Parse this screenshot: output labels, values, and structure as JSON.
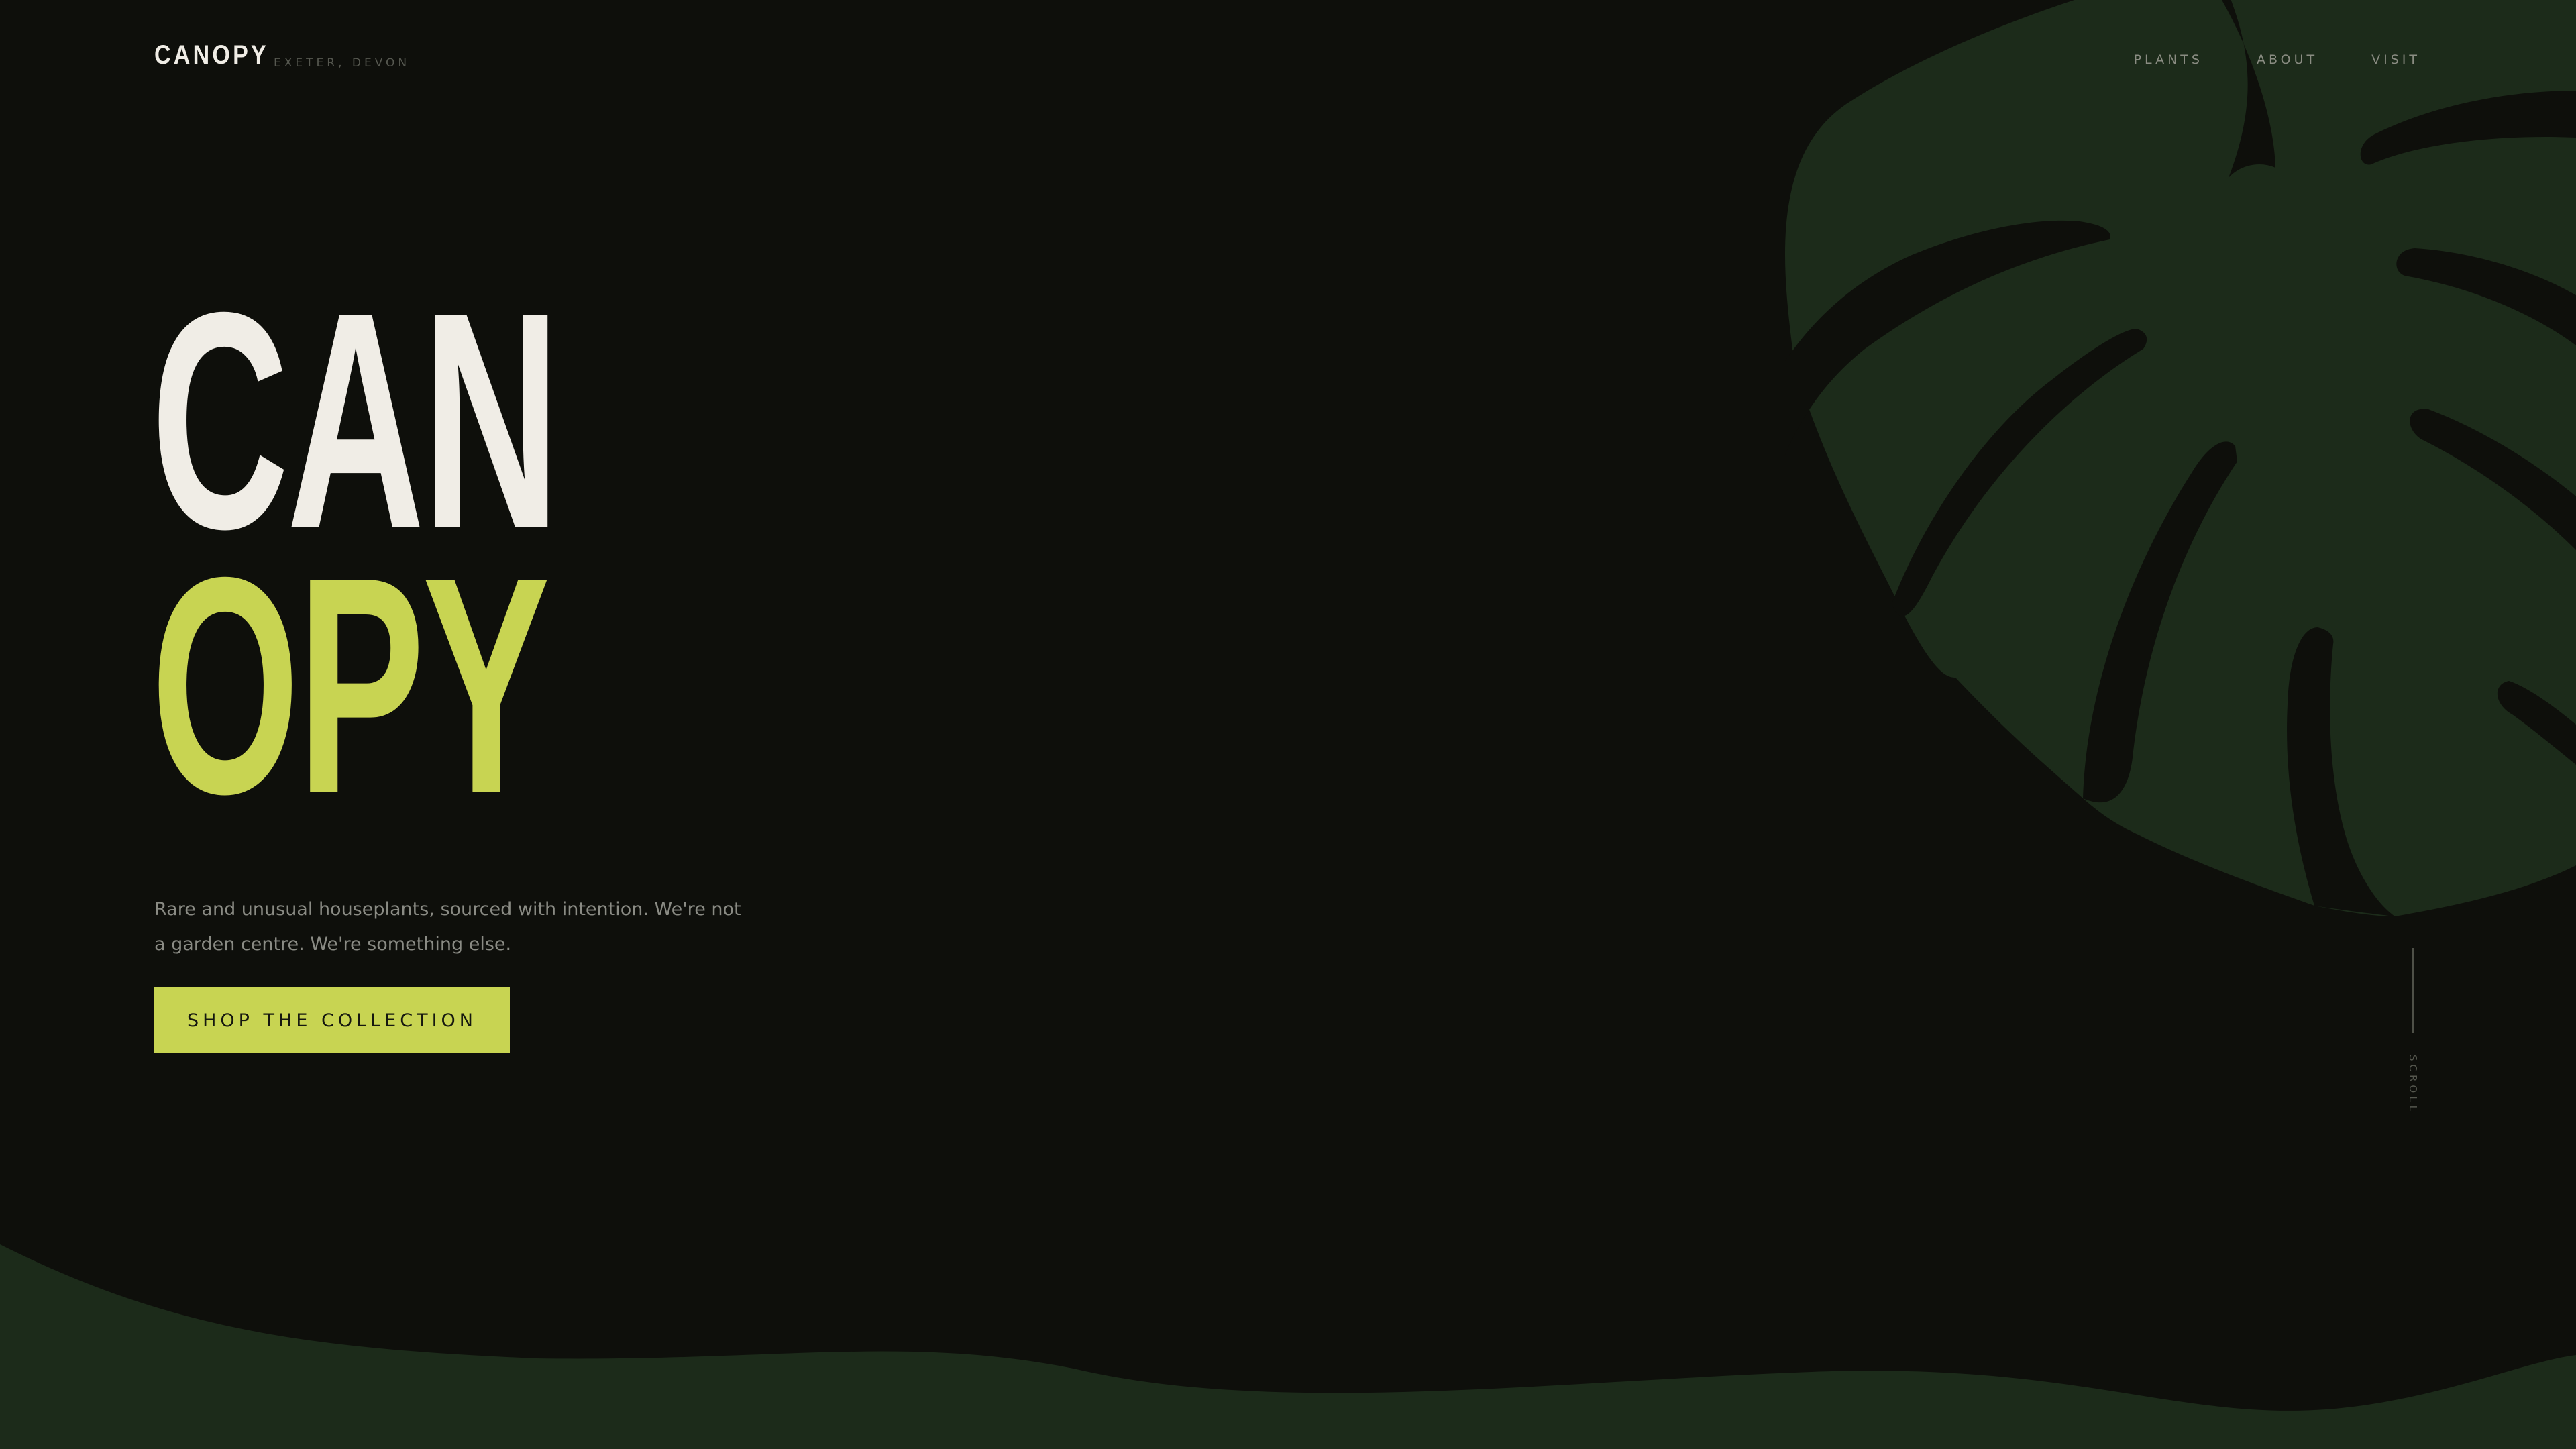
{
  "header": {
    "brand": "CANOPY",
    "location": "EXETER, DEVON",
    "nav": [
      "PLANTS",
      "ABOUT",
      "VISIT"
    ]
  },
  "hero": {
    "title_line_1": "CAN",
    "title_line_2": "OPY",
    "tagline": "Rare and unusual houseplants, sourced with intention. We're not a garden centre. We're something else.",
    "cta_label": "SHOP THE COLLECTION"
  },
  "scroll_indicator": {
    "label": "SCROLL"
  },
  "colors": {
    "background": "#0e0f0b",
    "leaf": "#1c2b1a",
    "accent": "#c8d452",
    "cream": "#f0ede6",
    "muted_text": "#8a8b84"
  },
  "icons": {
    "decoration": "monstera-leaf-icon"
  }
}
